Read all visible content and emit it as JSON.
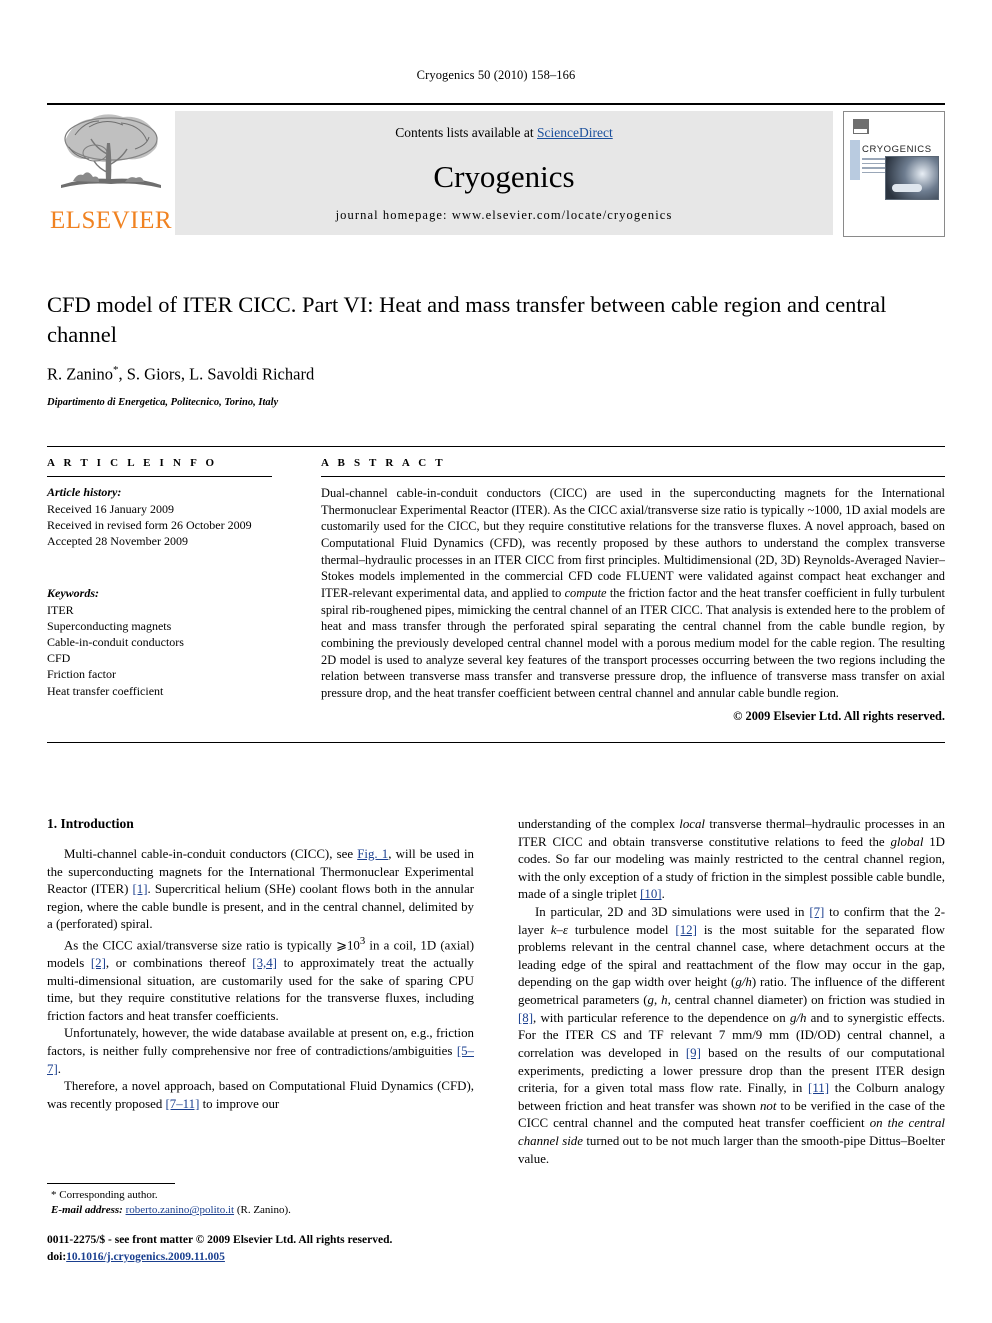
{
  "running_head": "Cryogenics 50 (2010) 158–166",
  "banner": {
    "publisher_name": "ELSEVIER",
    "contents_prefix": "Contents lists available at ",
    "contents_link": "ScienceDirect",
    "journal_name": "Cryogenics",
    "homepage": "journal homepage: www.elsevier.com/locate/cryogenics",
    "cover_title": "CRYOGENICS"
  },
  "article": {
    "title": "CFD model of ITER CICC. Part VI: Heat and mass transfer between cable region and central channel",
    "authors": "R. Zanino",
    "authors_rest": ", S. Giors, L. Savoldi Richard",
    "corresponding_marker": "*",
    "affiliation": "Dipartimento di Energetica, Politecnico, Torino, Italy"
  },
  "article_info": {
    "label": "A R T I C L E    I N F O",
    "history_heading": "Article history:",
    "history": [
      "Received 16 January 2009",
      "Received in revised form 26 October 2009",
      "Accepted 28 November 2009"
    ],
    "keywords_heading": "Keywords:",
    "keywords": [
      "ITER",
      "Superconducting magnets",
      "Cable-in-conduit conductors",
      "CFD",
      "Friction factor",
      "Heat transfer coefficient"
    ]
  },
  "abstract": {
    "label": "A B S T R A C T",
    "part1": "Dual-channel cable-in-conduit conductors (CICC) are used in the superconducting magnets for the International Thermonuclear Experimental Reactor (ITER). As the CICC axial/transverse size ratio is typically ~1000, 1D axial models are customarily used for the CICC, but they require constitutive relations for the transverse fluxes. A novel approach, based on Computational Fluid Dynamics (CFD), was recently proposed by these authors to understand the complex transverse thermal–hydraulic processes in an ITER CICC from first principles. Multidimensional (2D, 3D) Reynolds-Averaged Navier–Stokes models implemented in the commercial CFD code FLUENT were validated against compact heat exchanger and ITER-relevant experimental data, and applied to ",
    "italic1": "compute",
    "part2": " the friction factor and the heat transfer coefficient in fully turbulent spiral rib-roughened pipes, mimicking the central channel of an ITER CICC. That analysis is extended here to the problem of heat and mass transfer through the perforated spiral separating the central channel from the cable bundle region, by combining the previously developed central channel model with a porous medium model for the cable region. The resulting 2D model is used to analyze several key features of the transport processes occurring between the two regions including the relation between transverse mass transfer and transverse pressure drop, the influence of transverse mass transfer on axial pressure drop, and the heat transfer coefficient between central channel and annular cable bundle region.",
    "copyright": "© 2009 Elsevier Ltd. All rights reserved."
  },
  "introduction": {
    "heading": "1. Introduction",
    "left_paragraphs": [
      {
        "segments": [
          {
            "t": "Multi-channel cable-in-conduit conductors (CICC), see ",
            "s": "plain"
          },
          {
            "t": "Fig. 1",
            "s": "ref"
          },
          {
            "t": ", will be used in the superconducting magnets for the International Thermonuclear Experimental Reactor (ITER) ",
            "s": "plain"
          },
          {
            "t": "[1]",
            "s": "ref"
          },
          {
            "t": ". Supercritical helium (SHe) coolant flows both in the annular region, where the cable bundle is present, and in the central channel, delimited by a (perforated) spiral.",
            "s": "plain"
          }
        ]
      },
      {
        "segments": [
          {
            "t": "As the CICC axial/transverse size ratio is typically ⩾10",
            "s": "plain"
          },
          {
            "t": "3",
            "s": "sup"
          },
          {
            "t": " in a coil, 1D (axial) models ",
            "s": "plain"
          },
          {
            "t": "[2]",
            "s": "ref"
          },
          {
            "t": ", or combinations thereof ",
            "s": "plain"
          },
          {
            "t": "[3,4]",
            "s": "ref"
          },
          {
            "t": " to approximately treat the actually multi-dimensional situation, are customarily used for the sake of sparing CPU time, but they require constitutive relations for the transverse fluxes, including friction factors and heat transfer coefficients.",
            "s": "plain"
          }
        ]
      },
      {
        "segments": [
          {
            "t": "Unfortunately, however, the wide database available at present on, e.g., friction factors, is neither fully comprehensive nor free of contradictions/ambiguities ",
            "s": "plain"
          },
          {
            "t": "[5–7]",
            "s": "ref"
          },
          {
            "t": ".",
            "s": "plain"
          }
        ]
      },
      {
        "segments": [
          {
            "t": "Therefore, a novel approach, based on Computational Fluid Dynamics (CFD), was recently proposed ",
            "s": "plain"
          },
          {
            "t": "[7–11]",
            "s": "ref"
          },
          {
            "t": " to improve our",
            "s": "plain"
          }
        ]
      }
    ],
    "right_paragraphs": [
      {
        "indent": false,
        "segments": [
          {
            "t": "understanding of the complex ",
            "s": "plain"
          },
          {
            "t": "local",
            "s": "italic"
          },
          {
            "t": " transverse thermal–hydraulic processes in an ITER CICC and obtain transverse constitutive relations to feed the ",
            "s": "plain"
          },
          {
            "t": "global",
            "s": "italic"
          },
          {
            "t": " 1D codes. So far our modeling was mainly restricted to the central channel region, with the only exception of a study of friction in the simplest possible cable bundle, made of a single triplet ",
            "s": "plain"
          },
          {
            "t": "[10]",
            "s": "ref"
          },
          {
            "t": ".",
            "s": "plain"
          }
        ]
      },
      {
        "indent": true,
        "segments": [
          {
            "t": "In particular, 2D and 3D simulations were used in ",
            "s": "plain"
          },
          {
            "t": "[7]",
            "s": "ref"
          },
          {
            "t": " to confirm that the 2-layer ",
            "s": "plain"
          },
          {
            "t": "k–ε",
            "s": "italic"
          },
          {
            "t": " turbulence model ",
            "s": "plain"
          },
          {
            "t": "[12]",
            "s": "ref"
          },
          {
            "t": " is the most suitable for the separated flow problems relevant in the central channel case, where detachment occurs at the leading edge of the spiral and reattachment of the flow may occur in the gap, depending on the gap width over height (",
            "s": "plain"
          },
          {
            "t": "g/h",
            "s": "italic"
          },
          {
            "t": ") ratio. The influence of the different geometrical parameters (",
            "s": "plain"
          },
          {
            "t": "g",
            "s": "italic"
          },
          {
            "t": ", ",
            "s": "plain"
          },
          {
            "t": "h",
            "s": "italic"
          },
          {
            "t": ", central channel diameter) on friction was studied in ",
            "s": "plain"
          },
          {
            "t": "[8]",
            "s": "ref"
          },
          {
            "t": ", with particular reference to the dependence on ",
            "s": "plain"
          },
          {
            "t": "g/h",
            "s": "italic"
          },
          {
            "t": " and to synergistic effects. For the ITER CS and TF relevant 7 mm/9 mm (ID/OD) central channel, a correlation was developed in ",
            "s": "plain"
          },
          {
            "t": "[9]",
            "s": "ref"
          },
          {
            "t": " based on the results of our computational experiments, predicting a lower pressure drop than the present ITER design criteria, for a given total mass flow rate. Finally, in ",
            "s": "plain"
          },
          {
            "t": "[11]",
            "s": "ref"
          },
          {
            "t": " the Colburn analogy between friction and heat transfer was shown ",
            "s": "plain"
          },
          {
            "t": "not",
            "s": "italic"
          },
          {
            "t": " to be verified in the case of the CICC central channel and the computed heat transfer coefficient ",
            "s": "plain"
          },
          {
            "t": "on the central channel side",
            "s": "italic"
          },
          {
            "t": " turned out to be not much larger than the smooth-pipe Dittus–Boelter value.",
            "s": "plain"
          }
        ]
      }
    ]
  },
  "footnote": {
    "corresponding": "* Corresponding author.",
    "email_label": "E-mail address:",
    "email": "roberto.zanino@polito.it",
    "email_owner": " (R. Zanino)."
  },
  "footer": {
    "issn_line": "0011-2275/$ - see front matter © 2009 Elsevier Ltd. All rights reserved.",
    "doi_label": "doi:",
    "doi_value": "10.1016/j.cryogenics.2009.11.005"
  },
  "colors": {
    "elsevier_orange": "#F08221",
    "link_blue": "#1a3f8f",
    "sciencedirect_blue": "#1a4f9c",
    "banner_gray": "#e7e7e7"
  }
}
